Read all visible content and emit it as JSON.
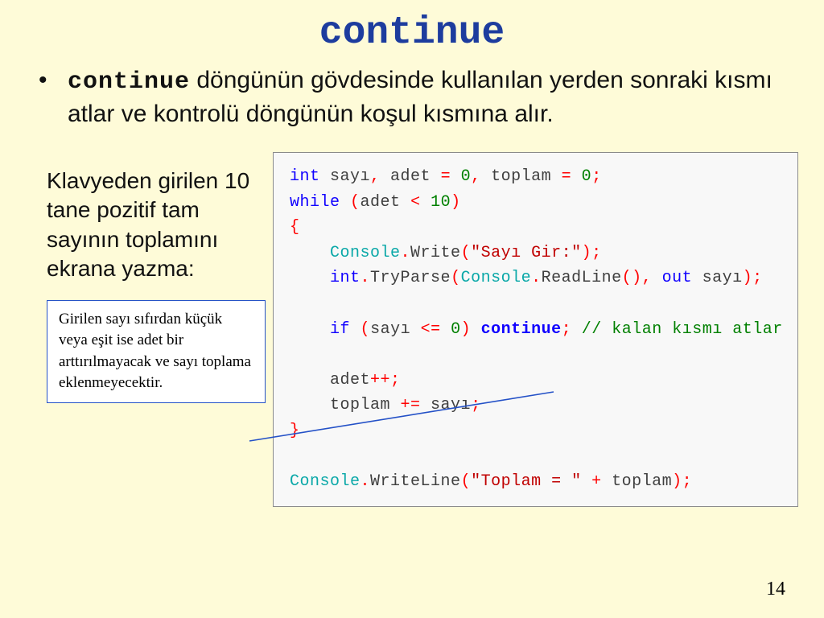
{
  "title": "continue",
  "bullet": {
    "keyword": "continue",
    "text_after": " döngünün gövdesinde kullanılan yerden sonraki kısmı atlar ve kontrolü döngünün koşul kısmına alır."
  },
  "left_desc": "Klavyeden girilen 10 tane pozitif tam sayının toplamını ekrana yazma:",
  "callout_text": "Girilen sayı sıfırdan küçük veya eşit ise adet bir arttırılmayacak ve sayı toplama eklenmeyecektir.",
  "code": {
    "l1_kw_int": "int",
    "l1_var1": " sayı",
    "l1_comma1": ",",
    "l1_var2": " adet ",
    "l1_eq1": "=",
    "l1_sp1": " ",
    "l1_zero1": "0",
    "l1_comma2": ",",
    "l1_var3": " toplam ",
    "l1_eq2": "=",
    "l1_sp2": " ",
    "l1_zero2": "0",
    "l1_semi": ";",
    "l2_while": "while",
    "l2_sp": " ",
    "l2_lp": "(",
    "l2_var": "adet ",
    "l2_lt": "<",
    "l2_sp2": " ",
    "l2_ten": "10",
    "l2_rp": ")",
    "l3": "{",
    "l4_indent": "    ",
    "l4_console": "Console",
    "l4_dot": ".",
    "l4_write": "Write",
    "l4_lp": "(",
    "l4_str": "\"Sayı Gir:\"",
    "l4_rp_semi": ");",
    "l5_indent": "    ",
    "l5_int": "int",
    "l5_dot": ".",
    "l5_tryparse": "TryParse",
    "l5_lp": "(",
    "l5_console": "Console",
    "l5_dot2": ".",
    "l5_readline": "ReadLine",
    "l5_paren": "(), ",
    "l5_out": "out",
    "l5_var": " sayı",
    "l5_rp_semi": ");",
    "l7_indent": "    ",
    "l7_if": "if",
    "l7_sp": " ",
    "l7_lp": "(",
    "l7_var": "sayı ",
    "l7_le": "<=",
    "l7_sp2": " ",
    "l7_zero": "0",
    "l7_rp": ")",
    "l7_sp3": " ",
    "l7_continue": "continue",
    "l7_semi": ";",
    "l7_cmt": " // kalan kısmı atlar",
    "l9_indent": "    ",
    "l9_var": "adet",
    "l9_inc": "++",
    "l9_semi": ";",
    "l10_indent": "    ",
    "l10_var": "toplam ",
    "l10_pluseq": "+=",
    "l10_var2": " sayı",
    "l10_semi": ";",
    "l11": "}",
    "l13_console": "Console",
    "l13_dot": ".",
    "l13_writeline": "WriteLine",
    "l13_lp": "(",
    "l13_str": "\"Toplam = \"",
    "l13_sp": " ",
    "l13_plus": "+",
    "l13_var": " toplam",
    "l13_rp_semi": ");"
  },
  "page_num": "14"
}
